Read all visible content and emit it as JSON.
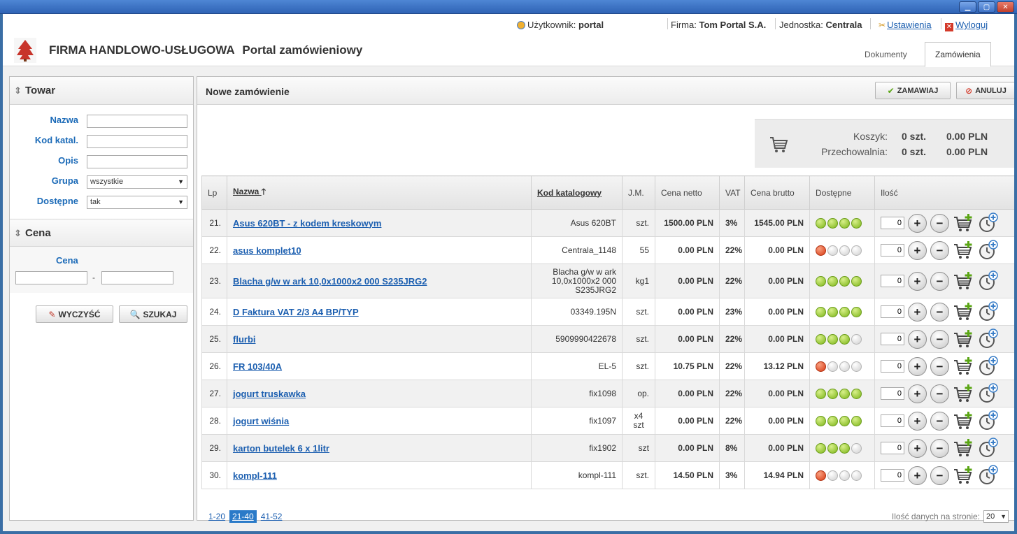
{
  "window": {
    "minimize": "▁",
    "maximize": "▢",
    "close": "✕"
  },
  "topbar": {
    "user_label": "Użytkownik:",
    "user_value": "portal",
    "firm_label": "Firma:",
    "firm_value": "Tom Portal S.A.",
    "unit_label": "Jednostka:",
    "unit_value": "Centrala",
    "settings": "Ustawienia",
    "logout": "Wyloguj"
  },
  "header": {
    "title_company": "FIRMA HANDLOWO-USŁUGOWA",
    "title_portal": "Portal zamówieniowy",
    "tabs": [
      {
        "label": "Dokumenty"
      },
      {
        "label": "Zamówienia"
      }
    ]
  },
  "left": {
    "towar_title": "Towar",
    "cena_title": "Cena",
    "labels": {
      "nazwa": "Nazwa",
      "kod": "Kod katal.",
      "opis": "Opis",
      "grupa": "Grupa",
      "dostepne": "Dostępne",
      "cena": "Cena"
    },
    "grupa_value": "wszystkie",
    "dostepne_value": "tak",
    "range_sep": "-",
    "clear_button": "WYCZYŚĆ",
    "search_button": "SZUKAJ"
  },
  "main": {
    "title": "Nowe zamówienie",
    "order_button": "ZAMAWIAJ",
    "cancel_button": "ANULUJ",
    "cart": {
      "koszyk_label": "Koszyk:",
      "koszyk_qty": "0 szt.",
      "koszyk_value": "0.00 PLN",
      "przech_label": "Przechowalnia:",
      "przech_qty": "0 szt.",
      "przech_value": "0.00 PLN"
    },
    "columns": {
      "lp": "Lp",
      "nazwa": "Nazwa",
      "nazwa_sort": "🡑",
      "kod": "Kod katalogowy",
      "jm": "J.M.",
      "netto": "Cena netto",
      "vat": "VAT",
      "brutto": "Cena brutto",
      "dostepne": "Dostępne",
      "ilosc": "Ilość"
    },
    "rows": [
      {
        "lp": "21.",
        "nazwa": "Asus 620BT - z kodem kreskowym",
        "kod": "Asus 620BT",
        "jm": "szt.",
        "netto": "1500.00 PLN",
        "vat": "3%",
        "brutto": "1545.00 PLN",
        "dots": [
          "green",
          "green",
          "green",
          "green"
        ],
        "qty": "0"
      },
      {
        "lp": "22.",
        "nazwa": "asus komplet10",
        "kod": "Centrala_1148",
        "jm": "55",
        "netto": "0.00 PLN",
        "vat": "22%",
        "brutto": "0.00 PLN",
        "dots": [
          "red",
          "grey",
          "grey",
          "grey"
        ],
        "qty": "0"
      },
      {
        "lp": "23.",
        "nazwa": "Blacha g/w w ark 10,0x1000x2 000 S235JRG2",
        "kod": "Blacha g/w w ark 10,0x1000x2 000 S235JRG2",
        "jm": "kg1",
        "netto": "0.00 PLN",
        "vat": "22%",
        "brutto": "0.00 PLN",
        "dots": [
          "green",
          "green",
          "green",
          "green"
        ],
        "qty": "0"
      },
      {
        "lp": "24.",
        "nazwa": "D Faktura VAT 2/3 A4 BP/TYP",
        "kod": "03349.195N",
        "jm": "szt.",
        "netto": "0.00 PLN",
        "vat": "23%",
        "brutto": "0.00 PLN",
        "dots": [
          "green",
          "green",
          "green",
          "green"
        ],
        "qty": "0"
      },
      {
        "lp": "25.",
        "nazwa": "flurbi",
        "kod": "5909990422678",
        "jm": "szt.",
        "netto": "0.00 PLN",
        "vat": "22%",
        "brutto": "0.00 PLN",
        "dots": [
          "green",
          "green",
          "green",
          "grey"
        ],
        "qty": "0"
      },
      {
        "lp": "26.",
        "nazwa": "FR 103/40A",
        "kod": "EL-5",
        "jm": "szt.",
        "netto": "10.75 PLN",
        "vat": "22%",
        "brutto": "13.12 PLN",
        "dots": [
          "red",
          "grey",
          "grey",
          "grey"
        ],
        "qty": "0"
      },
      {
        "lp": "27.",
        "nazwa": "jogurt truskawka",
        "kod": "fix1098",
        "jm": "op.",
        "netto": "0.00 PLN",
        "vat": "22%",
        "brutto": "0.00 PLN",
        "dots": [
          "green",
          "green",
          "green",
          "green"
        ],
        "qty": "0"
      },
      {
        "lp": "28.",
        "nazwa": "jogurt wiśnia",
        "kod": "fix1097",
        "jm": "x4 szt",
        "netto": "0.00 PLN",
        "vat": "22%",
        "brutto": "0.00 PLN",
        "dots": [
          "green",
          "green",
          "green",
          "green"
        ],
        "qty": "0"
      },
      {
        "lp": "29.",
        "nazwa": "karton butelek 6 x 1litr",
        "kod": "fix1902",
        "jm": "szt",
        "netto": "0.00 PLN",
        "vat": "8%",
        "brutto": "0.00 PLN",
        "dots": [
          "green",
          "green",
          "green",
          "grey"
        ],
        "qty": "0"
      },
      {
        "lp": "30.",
        "nazwa": "kompl-111",
        "kod": "kompl-111",
        "jm": "szt.",
        "netto": "14.50 PLN",
        "vat": "3%",
        "brutto": "14.94 PLN",
        "dots": [
          "red",
          "grey",
          "grey",
          "grey"
        ],
        "qty": "0"
      }
    ],
    "pager": [
      {
        "label": "1-20",
        "active": false
      },
      {
        "label": "21-40",
        "active": true
      },
      {
        "label": "41-52",
        "active": false
      }
    ],
    "perpage_label": "Ilość danych na stronie:",
    "perpage_value": "20"
  },
  "icons": {
    "plus": "+",
    "minus": "−",
    "sort": "⇕",
    "select_arrow": "▼",
    "check": "✔",
    "cancel": "⃠",
    "eraser": "✎",
    "search": "🔍",
    "tools": "✂",
    "logout": "✕"
  },
  "colors": {
    "accent": "#2a7ac8",
    "link": "#1c5fb0",
    "label": "#1c6bb8",
    "green": "#7cb518",
    "red": "#d83a14"
  }
}
